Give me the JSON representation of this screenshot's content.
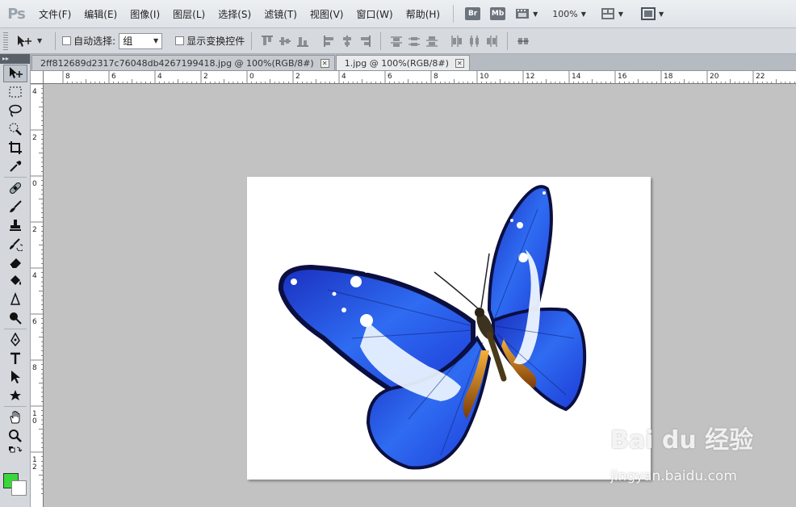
{
  "menubar": {
    "logo": "Ps",
    "items": [
      "文件(F)",
      "编辑(E)",
      "图像(I)",
      "图层(L)",
      "选择(S)",
      "滤镜(T)",
      "视图(V)",
      "窗口(W)",
      "帮助(H)"
    ],
    "bridge_label": "Br",
    "minibridge_label": "Mb",
    "zoom": "100%"
  },
  "options": {
    "auto_select_label": "自动选择:",
    "auto_select_value": "组",
    "show_transform_label": "显示变换控件"
  },
  "tabs": [
    {
      "label": "2ff812689d2317c76048db4267199418.jpg @ 100%(RGB/8#)",
      "active": false
    },
    {
      "label": "1.jpg @ 100%(RGB/8#)",
      "active": true
    }
  ],
  "rulers": {
    "horizontal_labels": [
      "8",
      "6",
      "4",
      "2",
      "0",
      "2",
      "4",
      "6",
      "8",
      "10",
      "12",
      "14",
      "16",
      "18",
      "20",
      "22"
    ],
    "vertical_labels": [
      "4",
      "2",
      "0",
      "2",
      "4",
      "6",
      "8",
      "10",
      "12"
    ]
  },
  "colors": {
    "foreground": "#39d83a",
    "background": "#ffffff"
  },
  "watermark": {
    "logo_text": "Bai du 经验",
    "url": "jingyan.baidu.com"
  }
}
